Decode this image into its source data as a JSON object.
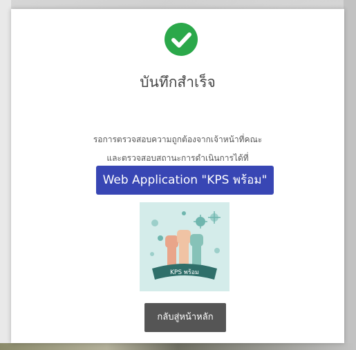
{
  "modal": {
    "title": "บันทึกสำเร็จ",
    "message_line1": "รอการตรวจสอบความถูกต้องจากเจ้าหน้าที่คณะ",
    "message_line2": "และตรวจสอบสถานะการดำเนินการได้ที่",
    "web_app_button_label": "Web Application \"KPS พร้อม\"",
    "home_button_label": "กลับสู่หน้าหลัก",
    "success_icon": "check-circle-icon",
    "image_badge_text": "KPS พร้อม"
  },
  "colors": {
    "success_green": "#2ba84a",
    "web_app_button_bg": "#3846b4",
    "home_button_bg": "#555555",
    "image_bg": "#d4ecea"
  }
}
